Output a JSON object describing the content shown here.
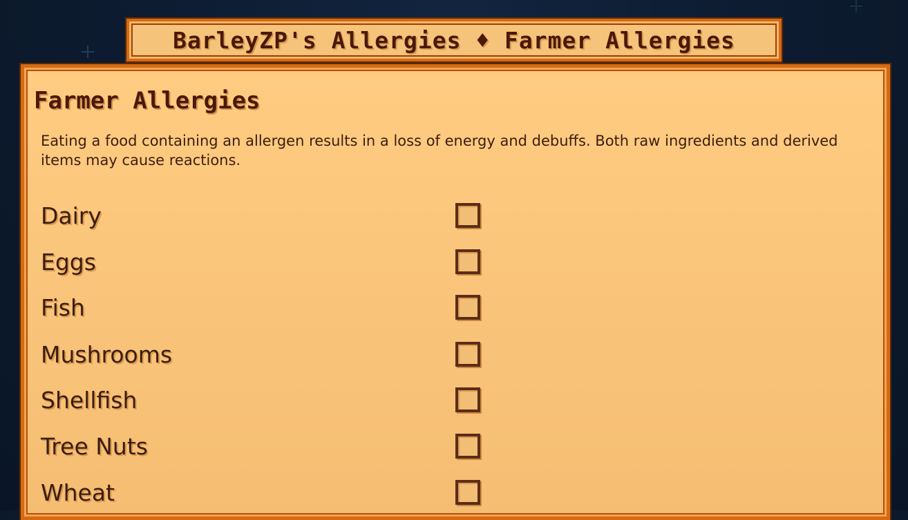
{
  "window": {
    "title": "BarleyZP's Allergies ♦ Farmer Allergies"
  },
  "panel": {
    "heading": "Farmer Allergies",
    "description": "Eating a food containing an allergen results in a loss of energy and debuffs. Both raw ingredients and derived items may cause reactions."
  },
  "allergens": [
    {
      "label": "Dairy",
      "checked": false
    },
    {
      "label": "Eggs",
      "checked": false
    },
    {
      "label": "Fish",
      "checked": false
    },
    {
      "label": "Mushrooms",
      "checked": false
    },
    {
      "label": "Shellfish",
      "checked": false
    },
    {
      "label": "Tree Nuts",
      "checked": false
    },
    {
      "label": "Wheat",
      "checked": false
    }
  ],
  "colors": {
    "background": "#0d1c31",
    "panel_fill": "#f9c47a",
    "border_orange": "#d66a14",
    "text_dark": "#3c1d10",
    "title_text": "#4a1908",
    "checkbox_border": "#5b2d17"
  },
  "icons": {
    "background_decoration": "sparkle-star-icon",
    "title_separator": "diamond-icon"
  }
}
